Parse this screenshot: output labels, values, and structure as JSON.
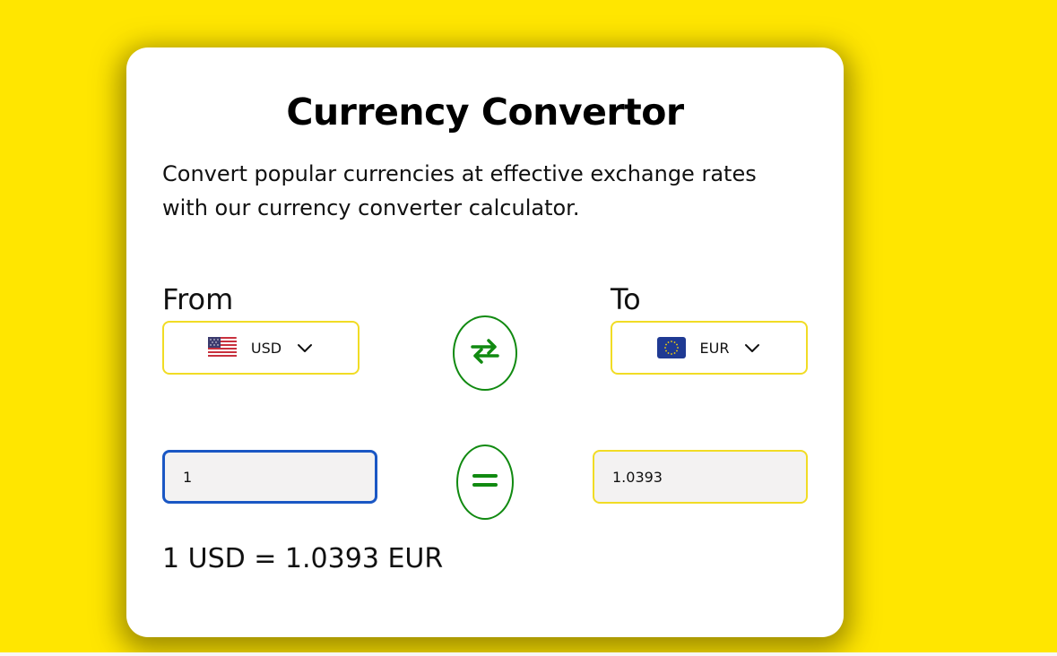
{
  "card": {
    "title": "Currency Convertor",
    "description": "Convert popular currencies at effective exchange rates with our currency converter calculator."
  },
  "from": {
    "label": "From",
    "currency": "USD",
    "flag_icon": "us-flag-icon",
    "amount": "1"
  },
  "to": {
    "label": "To",
    "currency": "EUR",
    "flag_icon": "eu-flag-icon",
    "amount": "1.0393"
  },
  "icons": {
    "swap": "swap-arrows-icon",
    "equals": "equals-icon",
    "dropdown": "chevron-down-icon"
  },
  "result": "1 USD = 1.0393 EUR",
  "colors": {
    "background": "#ffe600",
    "accent_green": "#118a11",
    "field_border_yellow": "#f1dc25",
    "focus_border_blue": "#1a57c4"
  }
}
